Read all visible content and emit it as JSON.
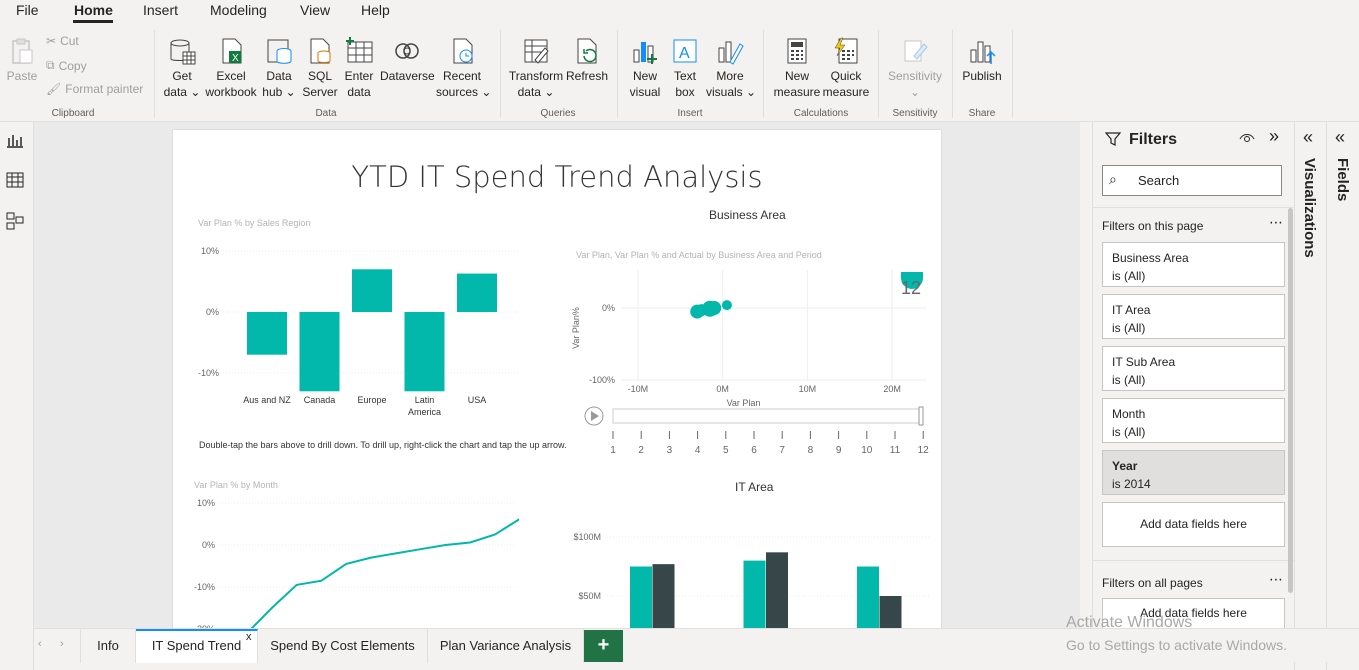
{
  "menu": {
    "file": "File",
    "home": "Home",
    "insert": "Insert",
    "modeling": "Modeling",
    "view": "View",
    "help": "Help"
  },
  "ribbon": {
    "clipboard": {
      "paste": "Paste",
      "cut": "Cut",
      "copy": "Copy",
      "format_painter": "Format painter",
      "group": "Clipboard"
    },
    "data": {
      "get_data": [
        "Get",
        "data"
      ],
      "excel": [
        "Excel",
        "workbook"
      ],
      "data_hub": [
        "Data",
        "hub"
      ],
      "sql": [
        "SQL",
        "Server"
      ],
      "enter": [
        "Enter",
        "data"
      ],
      "dataverse": "Dataverse",
      "recent": [
        "Recent",
        "sources"
      ],
      "group": "Data"
    },
    "queries": {
      "transform": [
        "Transform",
        "data"
      ],
      "refresh": "Refresh",
      "group": "Queries"
    },
    "insert": {
      "new_visual": [
        "New",
        "visual"
      ],
      "text_box": [
        "Text",
        "box"
      ],
      "more_visuals": [
        "More",
        "visuals"
      ],
      "group": "Insert"
    },
    "calculations": {
      "new_measure": [
        "New",
        "measure"
      ],
      "quick_measure": [
        "Quick",
        "measure"
      ],
      "group": "Calculations"
    },
    "sensitivity": {
      "label": "Sensitivity",
      "group": "Sensitivity"
    },
    "share": {
      "publish": "Publish",
      "group": "Share"
    }
  },
  "report": {
    "title": "YTD IT Spend Trend Analysis",
    "drill_note": "Double-tap the bars above to drill down. To drill up, right-click the chart and tap the up arrow.",
    "business_area_title": "Business Area",
    "it_area_title": "IT Area"
  },
  "chart_data": [
    {
      "type": "bar",
      "title": "Var Plan % by Sales Region",
      "categories": [
        "Aus and NZ",
        "Canada",
        "Europe",
        "Latin America",
        "USA"
      ],
      "values": [
        -7,
        -13,
        7,
        -13,
        6.3
      ],
      "yticks": [
        "10%",
        "0%",
        "-10%"
      ],
      "ylim": [
        -15,
        12
      ]
    },
    {
      "type": "scatter",
      "title": "Var Plan, Var Plan % and Actual by Business Area and Period",
      "xlabel": "Var Plan",
      "ylabel": "Var Plan%",
      "xticks": [
        "-10M",
        "0M",
        "10M",
        "20M"
      ],
      "yticks": [
        "0%",
        "-100%"
      ],
      "points": [
        [
          -3,
          -0.05
        ],
        [
          -2.5,
          -0.03
        ],
        [
          -1.5,
          -0.01
        ],
        [
          -1,
          0
        ],
        [
          0.5,
          0.04
        ]
      ],
      "period_label": "12",
      "play_ticks": [
        "1",
        "2",
        "3",
        "4",
        "5",
        "6",
        "7",
        "8",
        "9",
        "10",
        "11",
        "12"
      ]
    },
    {
      "type": "line",
      "title": "Var Plan % by Month",
      "yticks": [
        "10%",
        "0%",
        "-10%",
        "-20%"
      ],
      "values": [
        -21,
        -15,
        -9.5,
        -8.5,
        -4.5,
        -3,
        -2,
        -1,
        0,
        0.6,
        2.5,
        6.2
      ]
    },
    {
      "type": "bar",
      "title": "IT Area",
      "yticks": [
        "$100M",
        "$50M"
      ],
      "series": [
        {
          "color": "#01b8aa",
          "values": [
            75,
            80,
            75
          ]
        },
        {
          "color": "#374649",
          "values": [
            77,
            87,
            50
          ]
        }
      ]
    }
  ],
  "filters": {
    "title": "Filters",
    "search_placeholder": "Search",
    "on_page": "Filters on this page",
    "on_all": "Filters on all pages",
    "cards": [
      {
        "name": "Business Area",
        "value": "is (All)"
      },
      {
        "name": "IT Area",
        "value": "is (All)"
      },
      {
        "name": "IT Sub Area",
        "value": "is (All)"
      },
      {
        "name": "Month",
        "value": "is (All)"
      },
      {
        "name": "Year",
        "value": "is 2014"
      }
    ],
    "add_fields": "Add data fields here"
  },
  "panes": {
    "visualizations": "Visualizations",
    "fields": "Fields"
  },
  "tabs": [
    "Info",
    "IT Spend Trend",
    "Spend By Cost Elements",
    "Plan Variance Analysis"
  ],
  "watermark": {
    "line1": "Activate Windows",
    "line2": "Go to Settings to activate Windows."
  },
  "colors": {
    "teal": "#01b8aa",
    "dark": "#374649",
    "accent": "#118dff"
  }
}
